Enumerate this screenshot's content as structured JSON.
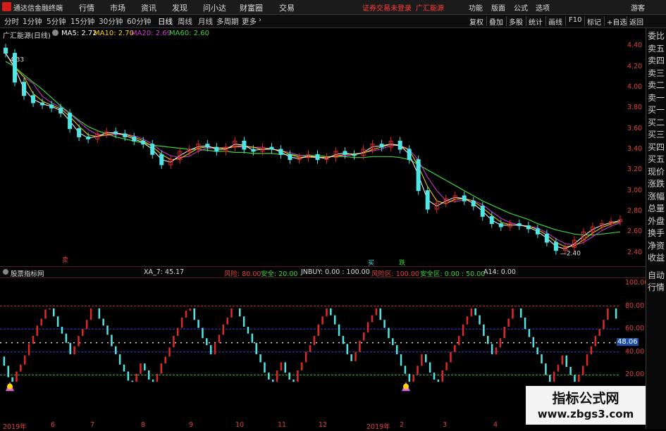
{
  "titlebar": {
    "app_name": "通达信金融终端",
    "menus": [
      "行情",
      "市场",
      "资讯",
      "发现",
      "问小达",
      "财富圈",
      "交易"
    ],
    "notice": "证券交易未登录",
    "stock_name": "广汇能源",
    "right_menus": [
      "功能",
      "版面",
      "公式",
      "选项"
    ],
    "guest": "游客"
  },
  "toolbar": {
    "timeframes": [
      "分时",
      "1分钟",
      "5分钟",
      "15分钟",
      "30分钟",
      "60分钟",
      "日线",
      "周线",
      "月线",
      "多周期",
      "更多"
    ],
    "buttons": [
      "复权",
      "叠加",
      "多股",
      "统计",
      "画线",
      "F10",
      "标记",
      "+自选",
      "返回"
    ]
  },
  "chart_header": {
    "title": "广汇能源(日线)",
    "ma5": "MA5: 2.72",
    "ma10": "MA10: 2.70",
    "ma20": "MA20: 2.69",
    "ma60": "MA60: 2.60"
  },
  "colors": {
    "ma5": "#ffffff",
    "ma10": "#ffd700",
    "ma20": "#d23cd2",
    "ma60": "#3cd23c",
    "up": "#e02828",
    "down": "#50e6e6"
  },
  "right_panel": [
    "委比",
    "卖五",
    "卖四",
    "卖三",
    "卖二",
    "卖一",
    "买一",
    "买二",
    "买三",
    "买四",
    "买五",
    "现价",
    "涨跌",
    "涨幅",
    "总量",
    "外盘",
    "换手",
    "净资",
    "收益"
  ],
  "right_panel_lower": [
    "自动",
    "行情"
  ],
  "price_axis": [
    "4.40",
    "4.20",
    "4.00",
    "3.80",
    "3.60",
    "3.40",
    "3.20",
    "3.00",
    "2.80",
    "2.60",
    "2.40"
  ],
  "price_labels": {
    "high": "4.33",
    "low": "2.40"
  },
  "indicator_header": {
    "name": "股票指标网",
    "xa7": "XA_7: 45.17",
    "risk": "风险: 80.00",
    "safe": "安全: 20.00",
    "jnbuy": "JNBUY: 0.00 : 100.00",
    "risk_zone": "风险区: 100.00",
    "safe_zone": "安全区: 0.00 : 50.00",
    "a14": "A14: 0.00"
  },
  "indicator_axis": [
    "100.00",
    "80.00",
    "60.00",
    "48.06",
    "40.00",
    "20.00"
  ],
  "current_value": "48.06",
  "markers": {
    "sell": "卖",
    "buy": "买",
    "fall": "跌"
  },
  "date_ticks": [
    "2019年",
    "6",
    "7",
    "8",
    "9",
    "10",
    "11",
    "12",
    "2019年",
    "2",
    "3",
    "4"
  ],
  "watermark": {
    "line1": "指标公式网",
    "line2": "www.zbgs3.com"
  },
  "chart_data": {
    "type": "candlestick",
    "title": "广汇能源(日线)",
    "price_range": [
      2.35,
      4.45
    ],
    "closes": [
      4.33,
      4.05,
      3.92,
      3.85,
      3.83,
      3.8,
      3.75,
      3.6,
      3.52,
      3.5,
      3.55,
      3.57,
      3.55,
      3.52,
      3.48,
      3.45,
      3.35,
      3.25,
      3.3,
      3.38,
      3.4,
      3.45,
      3.42,
      3.38,
      3.42,
      3.48,
      3.4,
      3.38,
      3.42,
      3.4,
      3.35,
      3.3,
      3.32,
      3.35,
      3.3,
      3.32,
      3.38,
      3.35,
      3.34,
      3.4,
      3.45,
      3.42,
      3.48,
      3.4,
      3.3,
      3.0,
      2.82,
      2.88,
      2.92,
      2.95,
      2.9,
      2.85,
      2.75,
      2.68,
      2.65,
      2.68,
      2.66,
      2.63,
      2.58,
      2.5,
      2.42,
      2.45,
      2.52,
      2.6,
      2.65,
      2.68,
      2.7,
      2.72
    ],
    "ma60": [
      4.25,
      4.2,
      4.12,
      4.05,
      3.98,
      3.9,
      3.82,
      3.75,
      3.68,
      3.62,
      3.58,
      3.55,
      3.52,
      3.5,
      3.48,
      3.46,
      3.44,
      3.43,
      3.42,
      3.41,
      3.4,
      3.4,
      3.39,
      3.38,
      3.38,
      3.37,
      3.37,
      3.36,
      3.36,
      3.36,
      3.35,
      3.35,
      3.34,
      3.34,
      3.34,
      3.33,
      3.33,
      3.33,
      3.32,
      3.32,
      3.33,
      3.33,
      3.33,
      3.32,
      3.3,
      3.25,
      3.2,
      3.15,
      3.1,
      3.05,
      3.0,
      2.95,
      2.9,
      2.86,
      2.82,
      2.78,
      2.75,
      2.72,
      2.68,
      2.65,
      2.62,
      2.6,
      2.58,
      2.57,
      2.57,
      2.58,
      2.59,
      2.6
    ]
  }
}
